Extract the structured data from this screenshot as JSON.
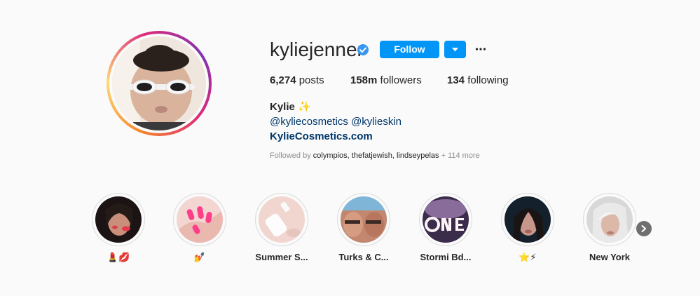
{
  "profile": {
    "username": "kyliejenner",
    "verified_icon": "verified-badge-icon",
    "follow_label": "Follow",
    "more_icon": "more-options-icon",
    "accent_color": "#0095f6"
  },
  "stats": {
    "posts_count": "6,274",
    "posts_label": "posts",
    "followers_count": "158m",
    "followers_label": "followers",
    "following_count": "134",
    "following_label": "following"
  },
  "bio": {
    "name": "Kylie ✨",
    "mentions": "@kyliecosmetics @kylieskin",
    "link": "KylieCosmetics.com",
    "followed_by_prefix": "Followed by",
    "followed_by_names": "colympios, thefatjewish, lindseypelas",
    "followed_by_more": "+ 114 more"
  },
  "highlights": [
    {
      "label": "💄💋"
    },
    {
      "label": "💅"
    },
    {
      "label": "Summer S..."
    },
    {
      "label": "Turks & C..."
    },
    {
      "label": "Stormi Bd..."
    },
    {
      "label": "⭐⚡"
    },
    {
      "label": "New York"
    }
  ]
}
